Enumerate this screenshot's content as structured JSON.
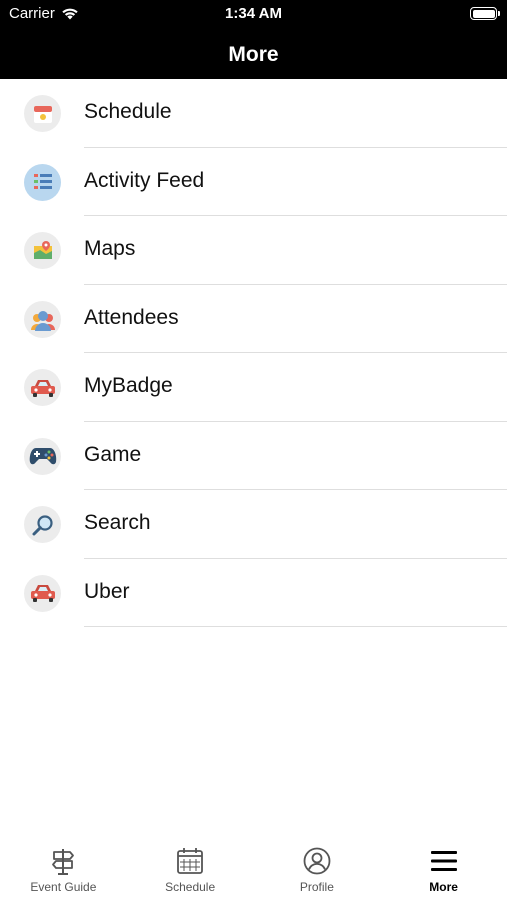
{
  "status_bar": {
    "carrier": "Carrier",
    "time": "1:34 AM"
  },
  "nav": {
    "title": "More"
  },
  "menu": [
    {
      "label": "Schedule",
      "icon": "calendar-icon"
    },
    {
      "label": "Activity Feed",
      "icon": "activity-feed-icon"
    },
    {
      "label": "Maps",
      "icon": "map-icon"
    },
    {
      "label": "Attendees",
      "icon": "attendees-icon"
    },
    {
      "label": "MyBadge",
      "icon": "car-icon"
    },
    {
      "label": "Game",
      "icon": "gamepad-icon"
    },
    {
      "label": "Search",
      "icon": "search-icon"
    },
    {
      "label": "Uber",
      "icon": "car-icon"
    }
  ],
  "tabs": [
    {
      "label": "Event Guide",
      "icon": "signpost-icon",
      "active": false
    },
    {
      "label": "Schedule",
      "icon": "calendar-icon",
      "active": false
    },
    {
      "label": "Profile",
      "icon": "profile-icon",
      "active": false
    },
    {
      "label": "More",
      "icon": "menu-icon",
      "active": true
    }
  ],
  "colors": {
    "header_bg": "#000000",
    "separator": "#dedede",
    "icon_bg": "#ececec"
  }
}
